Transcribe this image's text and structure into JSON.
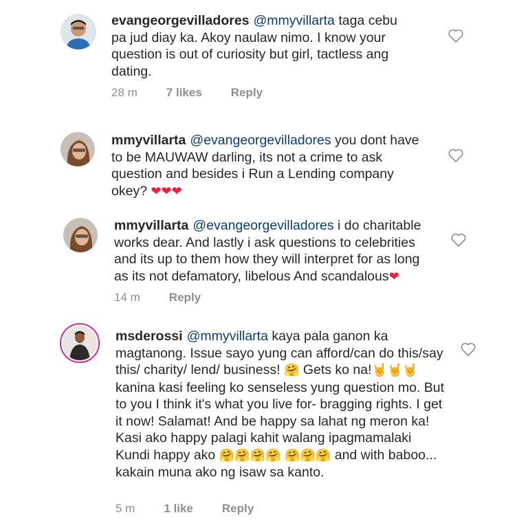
{
  "comments": [
    {
      "username": "evangeorgevilladores",
      "mention": "@mmyvillarta",
      "text": "taga cebu pa jud diay ka. Akoy naulaw nimo. I know your question is out of curiosity but girl, tactless ang dating.",
      "time": "28 m",
      "likes": "7 likes",
      "reply": "Reply"
    },
    {
      "username": "mmyvillarta",
      "mention": "@evangeorgevilladores",
      "text": "you dont have to be MAUWAW darling, its not a crime to ask question and besides i Run a Lending company okey?",
      "emoji": "❤❤❤"
    },
    {
      "username": "mmyvillarta",
      "mention": "@evangeorgevilladores",
      "text": "i do charitable works dear. And lastly i ask questions to celebrities and its up to them how they will interpret for as long as its not defamatory, libelous And scandalous",
      "emoji": "❤",
      "time": "14 m",
      "reply": "Reply"
    },
    {
      "username": "msderossi",
      "mention": "@mmyvillarta",
      "text_1": "kaya pala ganon ka magtanong. Issue sayo yung can afford/can do this/say this/ charity/ lend/ business!",
      "emoji_1": "🤗",
      "text_2": "Gets ko na!",
      "emoji_2": "🤘🤘🤘",
      "text_3": "kanina kasi feeling ko senseless yung question mo. But to you I think it's what you live for- bragging rights. I get it now! Salamat! And be happy sa lahat ng meron ka! Kasi ako happy palagi kahit walang ipagmamalaki Kundi happy ako",
      "emoji_3": "🤗🤗🤗🤗 🤗🤗🤗",
      "text_4": "and with baboo... kakain muna ako ng isaw sa kanto.",
      "time": "5 m",
      "likes": "1 like",
      "reply": "Reply"
    }
  ],
  "icons": {
    "heart": "heart-outline-icon",
    "heart_stroke": "#8e8e8e"
  }
}
